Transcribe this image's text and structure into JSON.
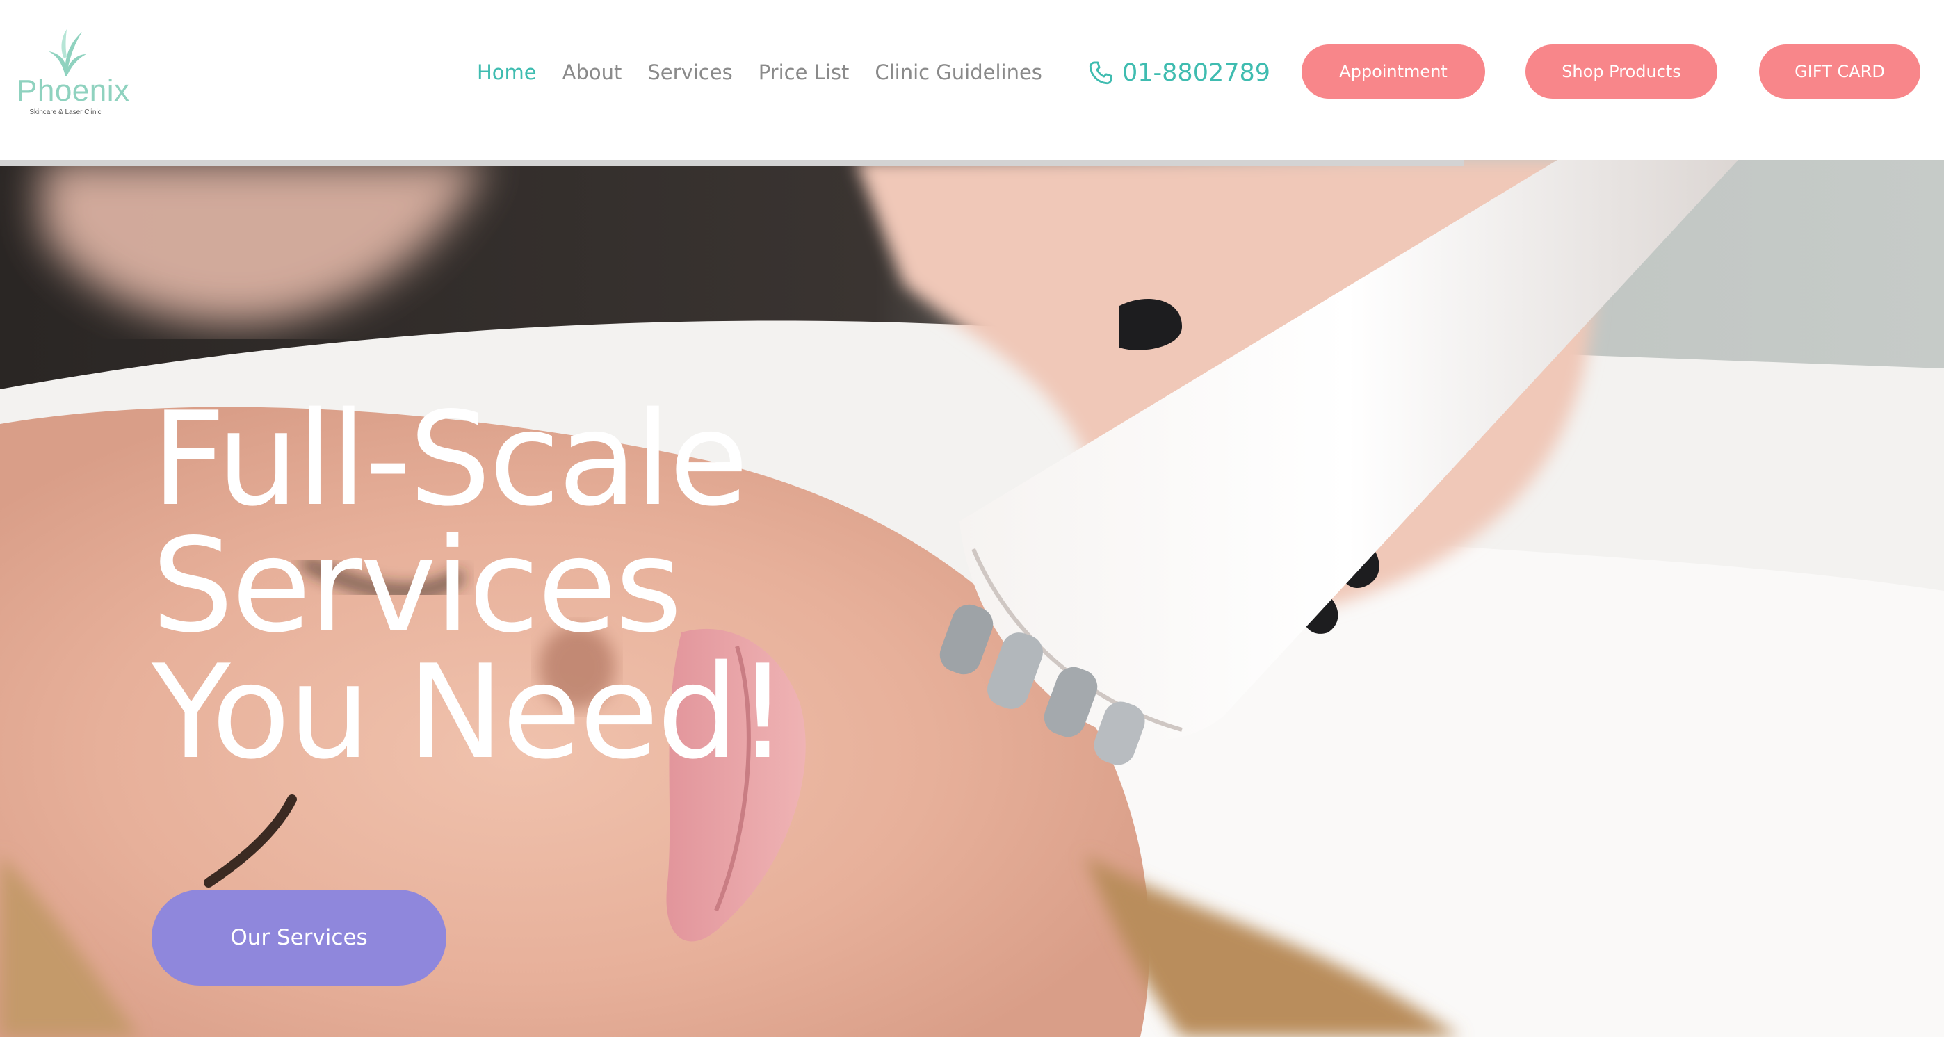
{
  "brand": {
    "name": "Phoenix",
    "tagline": "Skincare & Laser Clinic",
    "logo_color": "#8fd2bf"
  },
  "nav": {
    "items": [
      {
        "label": "Home",
        "active": true
      },
      {
        "label": "About",
        "active": false
      },
      {
        "label": "Services",
        "active": false
      },
      {
        "label": "Price List",
        "active": false
      },
      {
        "label": "Clinic Guidelines",
        "active": false
      }
    ],
    "active_color": "#3fbcb0",
    "inactive_color": "#8a8a8a"
  },
  "phone": {
    "icon": "phone-icon",
    "number": "01-8802789"
  },
  "header_buttons": {
    "appointment": "Appointment",
    "shop": "Shop Products",
    "gift": "GIFT CARD",
    "color": "#f8868a"
  },
  "hero": {
    "title_lines": [
      "Full-Scale",
      "Services",
      "You Need!"
    ],
    "cta": "Our Services",
    "cta_color": "#8f87dc",
    "image": "woman receiving facial skin treatment with a white multi-prong device"
  }
}
